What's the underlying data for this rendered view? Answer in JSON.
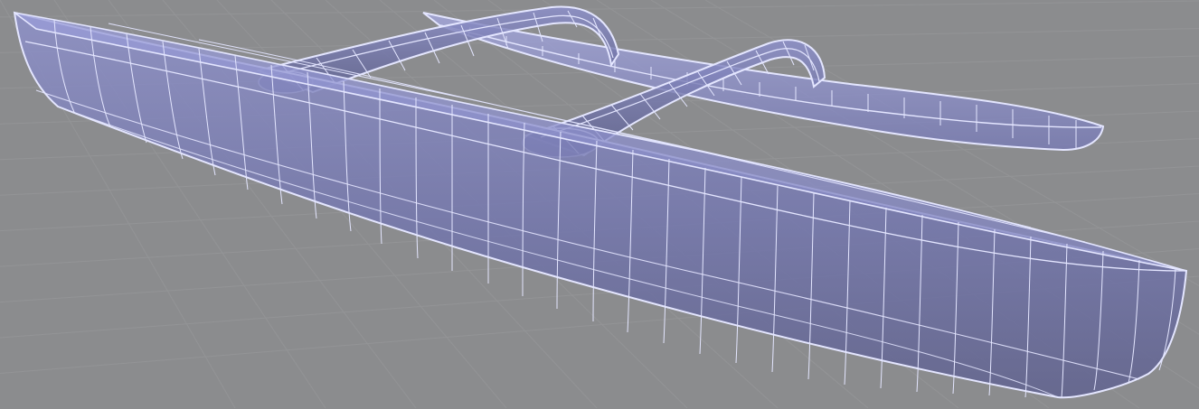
{
  "viewport": {
    "background": "#8b8c8e",
    "grid_color": "#9a9b9d",
    "model": {
      "fill": "#7d80b8",
      "wire": "#e4e6ff",
      "parts": [
        "main-hull",
        "outrigger-float",
        "front-aka",
        "rear-aka"
      ]
    }
  }
}
